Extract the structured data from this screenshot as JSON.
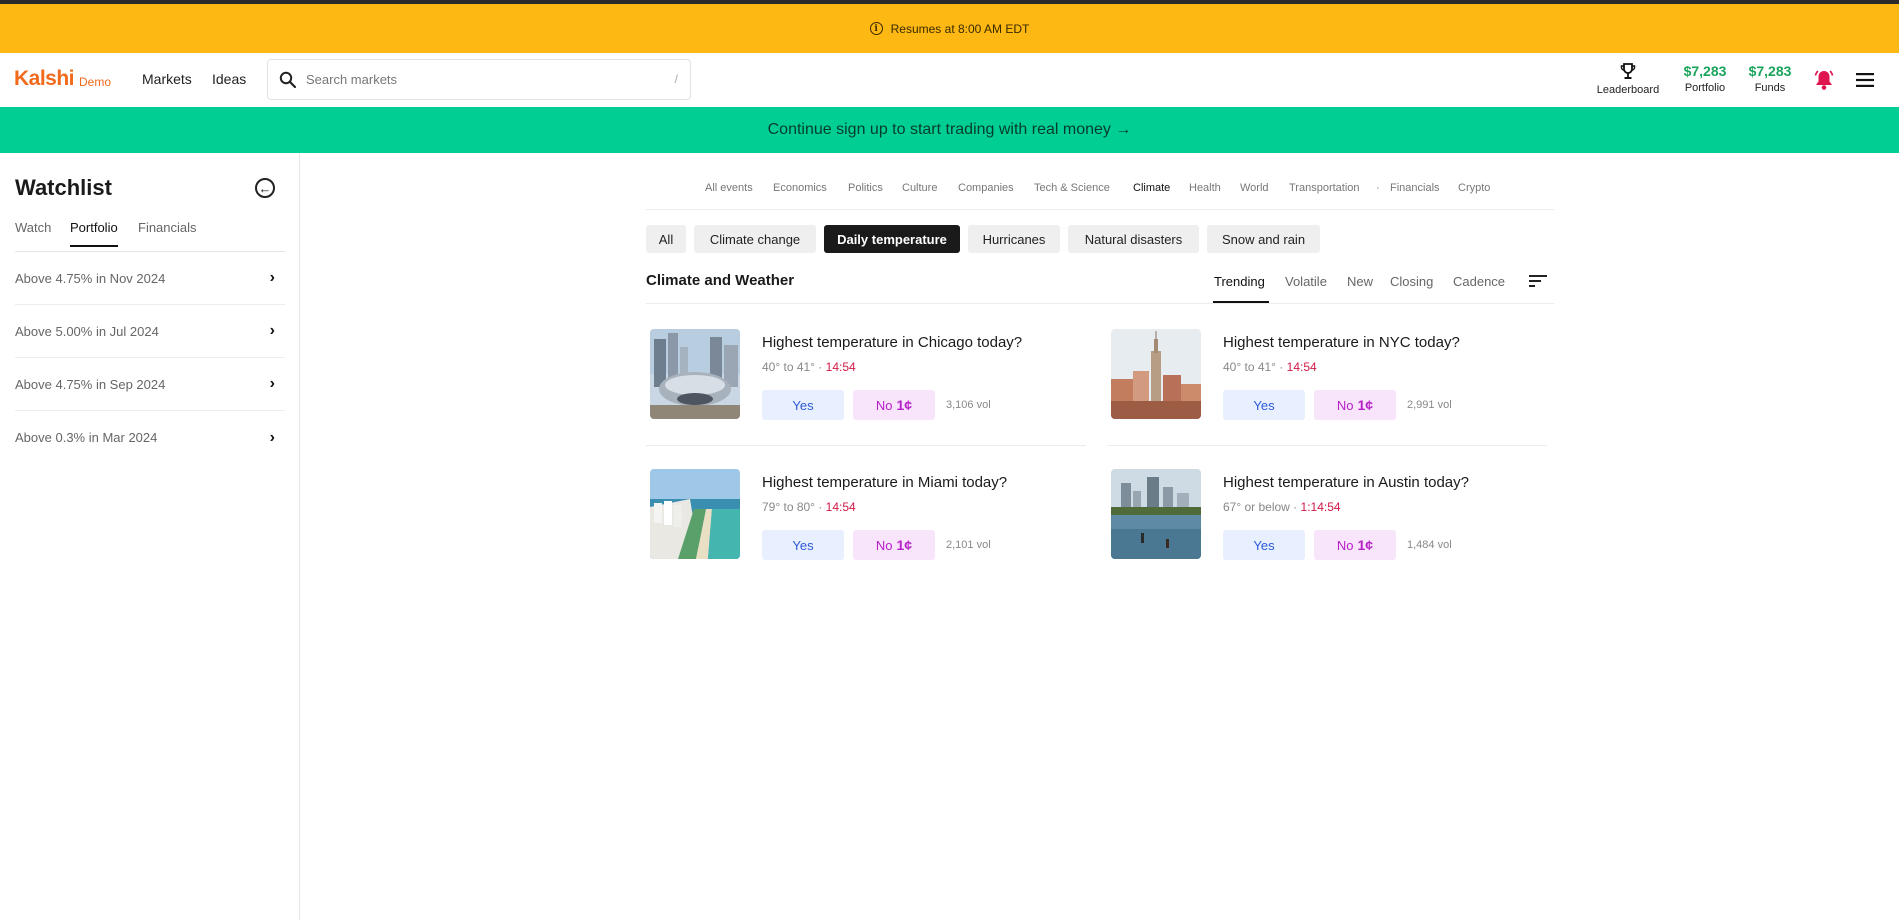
{
  "banner": {
    "text": "Resumes at 8:00 AM EDT",
    "icon": "info-icon"
  },
  "nav": {
    "logo": "Kalshi",
    "demo": "Demo",
    "links": [
      "Markets",
      "Ideas"
    ],
    "search_placeholder": "Search markets",
    "search_shortcut": "/",
    "leaderboard": "Leaderboard",
    "portfolio_value": "$7,283",
    "portfolio_label": "Portfolio",
    "funds_value": "$7,283",
    "funds_label": "Funds",
    "colors": {
      "brand": "#f26a1b",
      "money": "#1aa35c",
      "bell": "#e0154f"
    }
  },
  "signup": {
    "text": "Continue sign up to start trading with real money →",
    "color": "#00ce93"
  },
  "watchlist": {
    "title": "Watchlist",
    "tabs": [
      "Watch",
      "Portfolio",
      "Financials"
    ],
    "active_tab": "Portfolio",
    "items": [
      "Above 4.75% in Nov 2024",
      "Above 5.00% in Jul 2024",
      "Above 4.75% in Sep 2024",
      "Above 0.3% in Mar 2024"
    ]
  },
  "categories": {
    "items": [
      "All events",
      "Economics",
      "Politics",
      "Culture",
      "Companies",
      "Tech & Science",
      "Climate",
      "Health",
      "World",
      "Transportation",
      "·",
      "Financials",
      "Crypto"
    ],
    "active": "Climate"
  },
  "chips": {
    "items": [
      "All",
      "Climate change",
      "Daily temperature",
      "Hurricanes",
      "Natural disasters",
      "Snow and rain"
    ],
    "active": "Daily temperature"
  },
  "section": {
    "title": "Climate and Weather",
    "sort_tabs": [
      "Trending",
      "Volatile",
      "New",
      "Closing",
      "Cadence"
    ],
    "active_sort": "Trending"
  },
  "markets": [
    {
      "title": "Highest temperature in Chicago today?",
      "range": "40° to 41° · ",
      "time": "14:54",
      "yes": "Yes",
      "no": "No",
      "price": "1¢",
      "vol": "3,106 vol",
      "image": "chicago-bean"
    },
    {
      "title": "Highest temperature in NYC today?",
      "range": "40° to 41° · ",
      "time": "14:54",
      "yes": "Yes",
      "no": "No",
      "price": "1¢",
      "vol": "2,991 vol",
      "image": "nyc-skyline"
    },
    {
      "title": "Highest temperature in Miami today?",
      "range": "79° to 80° · ",
      "time": "14:54",
      "yes": "Yes",
      "no": "No",
      "price": "1¢",
      "vol": "2,101 vol",
      "image": "miami-beach"
    },
    {
      "title": "Highest temperature in Austin today?",
      "range": "67° or below · ",
      "time": "1:14:54",
      "yes": "Yes",
      "no": "No",
      "price": "1¢",
      "vol": "1,484 vol",
      "image": "austin-lake"
    }
  ]
}
